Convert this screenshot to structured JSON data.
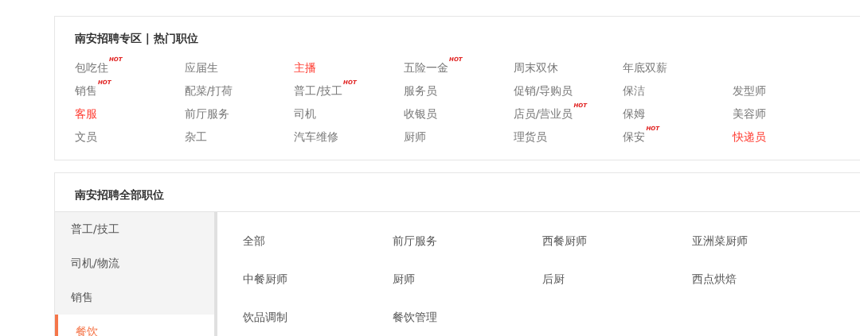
{
  "hot_section": {
    "title": "南安招聘专区 | 热门职位",
    "rows": [
      [
        {
          "label": "包吃住",
          "highlighted": false,
          "badge": "HOT"
        },
        {
          "label": "应届生",
          "highlighted": false
        },
        {
          "label": "主播",
          "highlighted": true
        },
        {
          "label": "五险一金",
          "highlighted": false,
          "badge": "HOT"
        },
        {
          "label": "周末双休",
          "highlighted": false
        },
        {
          "label": "年底双薪",
          "highlighted": false
        }
      ],
      [
        {
          "label": "销售",
          "highlighted": false,
          "badge": "HOT"
        },
        {
          "label": "配菜/打荷",
          "highlighted": false
        },
        {
          "label": "普工/技工",
          "highlighted": false,
          "badge": "HOT"
        },
        {
          "label": "服务员",
          "highlighted": false
        },
        {
          "label": "促销/导购员",
          "highlighted": false
        },
        {
          "label": "保洁",
          "highlighted": false
        },
        {
          "label": "发型师",
          "highlighted": false
        }
      ],
      [
        {
          "label": "客服",
          "highlighted": true
        },
        {
          "label": "前厅服务",
          "highlighted": false
        },
        {
          "label": "司机",
          "highlighted": false
        },
        {
          "label": "收银员",
          "highlighted": false
        },
        {
          "label": "店员/营业员",
          "highlighted": false,
          "badge": "HOT"
        },
        {
          "label": "保姆",
          "highlighted": false
        },
        {
          "label": "美容师",
          "highlighted": false
        }
      ],
      [
        {
          "label": "文员",
          "highlighted": false
        },
        {
          "label": "杂工",
          "highlighted": false
        },
        {
          "label": "汽车维修",
          "highlighted": false
        },
        {
          "label": "厨师",
          "highlighted": false
        },
        {
          "label": "理货员",
          "highlighted": false
        },
        {
          "label": "保安",
          "highlighted": false,
          "badge": "HOT"
        },
        {
          "label": "快递员",
          "highlighted": true
        }
      ]
    ]
  },
  "all_section": {
    "title": "南安招聘全部职位",
    "categories": [
      {
        "label": "普工/技工",
        "selected": false
      },
      {
        "label": "司机/物流",
        "selected": false
      },
      {
        "label": "销售",
        "selected": false
      },
      {
        "label": "餐饮",
        "selected": true
      }
    ],
    "positions": [
      "全部",
      "前厅服务",
      "西餐厨师",
      "亚洲菜厨师",
      "中餐厨师",
      "厨师",
      "后厨",
      "西点烘焙",
      "饮品调制",
      "餐饮管理"
    ]
  }
}
